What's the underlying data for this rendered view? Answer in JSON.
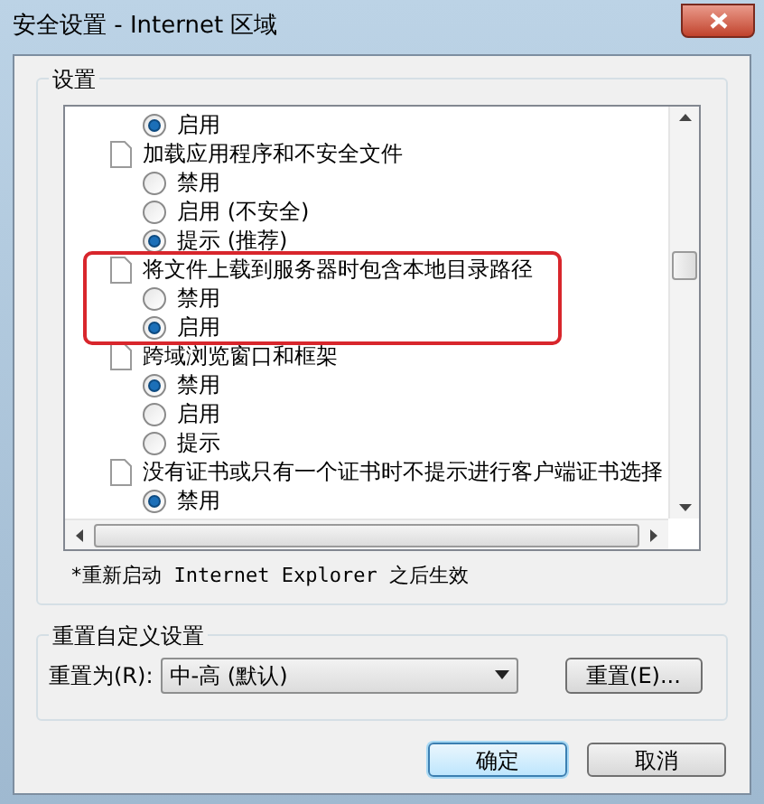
{
  "window": {
    "title": "安全设置 - Internet 区域"
  },
  "settings_group": {
    "title": "设置",
    "rows": [
      {
        "kind": "option",
        "label": "启用",
        "selected": true
      },
      {
        "kind": "setting",
        "label": "加载应用程序和不安全文件",
        "highlighted": false,
        "options": [
          {
            "label": "禁用",
            "selected": false
          },
          {
            "label": "启用 (不安全)",
            "selected": false
          },
          {
            "label": "提示 (推荐)",
            "selected": true
          }
        ]
      },
      {
        "kind": "setting",
        "label": "将文件上载到服务器时包含本地目录路径",
        "highlighted": true,
        "options": [
          {
            "label": "禁用",
            "selected": false
          },
          {
            "label": "启用",
            "selected": true
          }
        ]
      },
      {
        "kind": "setting",
        "label": "跨域浏览窗口和框架",
        "highlighted": false,
        "options": [
          {
            "label": "禁用",
            "selected": true
          },
          {
            "label": "启用",
            "selected": false
          },
          {
            "label": "提示",
            "selected": false
          }
        ]
      },
      {
        "kind": "setting",
        "label": "没有证书或只有一个证书时不提示进行客户端证书选择",
        "highlighted": false,
        "options": [
          {
            "label": "禁用",
            "selected": true
          }
        ]
      }
    ],
    "note": "*重新启动 Internet Explorer 之后生效"
  },
  "reset_group": {
    "title": "重置自定义设置",
    "label": "重置为(R):",
    "value": "中-高 (默认)",
    "button": "重置(E)..."
  },
  "buttons": [
    {
      "label": "确定",
      "default": true
    },
    {
      "label": "取消",
      "default": false
    }
  ]
}
